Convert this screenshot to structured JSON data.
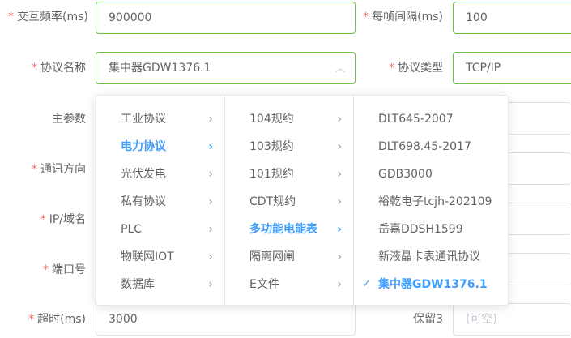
{
  "form": {
    "interaction_freq": {
      "label": "交互频率(ms)",
      "value": "900000",
      "required": true
    },
    "frame_interval": {
      "label": "每帧间隔(ms)",
      "value": "100",
      "required": true
    },
    "protocol_name": {
      "label": "协议名称",
      "value": "集中器GDW1376.1",
      "required": true
    },
    "protocol_type": {
      "label": "协议类型",
      "value": "TCP/IP",
      "required": true
    },
    "main_params": {
      "label": "主参数"
    },
    "comm_direction": {
      "label": "通讯方向",
      "required": true
    },
    "ip_domain": {
      "label": "IP/域名",
      "required": true
    },
    "port": {
      "label": "端口号",
      "required": true
    },
    "timeout": {
      "label": "超时(ms)",
      "value": "3000",
      "required": true
    },
    "reserved3": {
      "label": "保留3",
      "placeholder": "(可空)"
    }
  },
  "cascader": {
    "level1": [
      "工业协议",
      "电力协议",
      "光伏发电",
      "私有协议",
      "PLC",
      "物联网IOT",
      "数据库"
    ],
    "level2": [
      "104规约",
      "103规约",
      "101规约",
      "CDT规约",
      "多功能电能表",
      "隔离网闸",
      "E文件"
    ],
    "level3": [
      "DLT645-2007",
      "DLT698.45-2017",
      "GDB3000",
      "裕乾电子tcjh-202109",
      "岳嘉DDSH1599",
      "新液晶卡表通讯协议",
      "集中器GDW1376.1"
    ],
    "active_level1": 1,
    "active_level2": 4,
    "selected_level3": 6
  },
  "colors": {
    "accent": "#409eff",
    "required": "#f56c6c",
    "valid_border": "#67c23a"
  }
}
